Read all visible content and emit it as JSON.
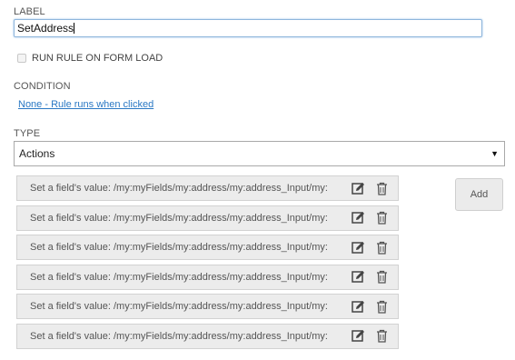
{
  "label_section": {
    "heading": "LABEL",
    "value": "SetAddress"
  },
  "run_on_load": {
    "label": "RUN RULE ON FORM LOAD",
    "checked": false
  },
  "condition_section": {
    "heading": "CONDITION",
    "link_text": "None - Rule runs when clicked"
  },
  "type_section": {
    "heading": "TYPE",
    "selected": "Actions"
  },
  "actions": [
    {
      "text": "Set a field's value: /my:myFields/my:address/my:address_Input/my:"
    },
    {
      "text": "Set a field's value: /my:myFields/my:address/my:address_Input/my:"
    },
    {
      "text": "Set a field's value: /my:myFields/my:address/my:address_Input/my:"
    },
    {
      "text": "Set a field's value: /my:myFields/my:address/my:address_Input/my:"
    },
    {
      "text": "Set a field's value: /my:myFields/my:address/my:address_Input/my:"
    },
    {
      "text": "Set a field's value: /my:myFields/my:address/my:address_Input/my:"
    }
  ],
  "add_button_label": "Add",
  "icons": {
    "edit": "edit-icon",
    "delete": "trash-icon",
    "dropdown": "chevron-down-icon"
  },
  "colors": {
    "link": "#2a78c4",
    "input_focus_border": "#8fb6dc",
    "row_background": "#ececec"
  }
}
